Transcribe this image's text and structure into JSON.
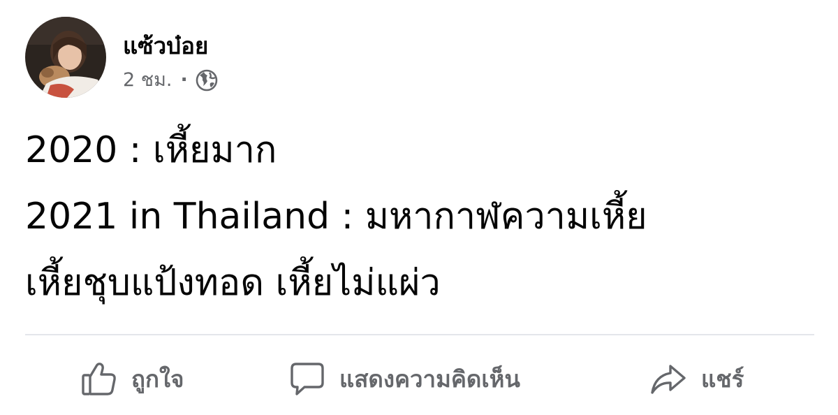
{
  "post": {
    "author": "แซ้วบ๋อย",
    "time": "2 ชม.",
    "separator": "·",
    "audience_icon": "globe-icon",
    "lines": [
      "2020 : เหี้ยมาก",
      "2021 in Thailand : มหากาฬความเหี้ย",
      "เหี้ยชุบแป้งทอด เหี้ยไม่แผ่ว"
    ]
  },
  "actions": {
    "like": {
      "label": "ถูกใจ",
      "icon": "thumbs-up-icon"
    },
    "comment": {
      "label": "แสดงความคิดเห็น",
      "icon": "comment-icon"
    },
    "share": {
      "label": "แชร์",
      "icon": "share-icon"
    }
  },
  "colors": {
    "primary_text": "#050505",
    "secondary_text": "#65676b",
    "divider": "#e4e6eb",
    "background": "#ffffff"
  }
}
